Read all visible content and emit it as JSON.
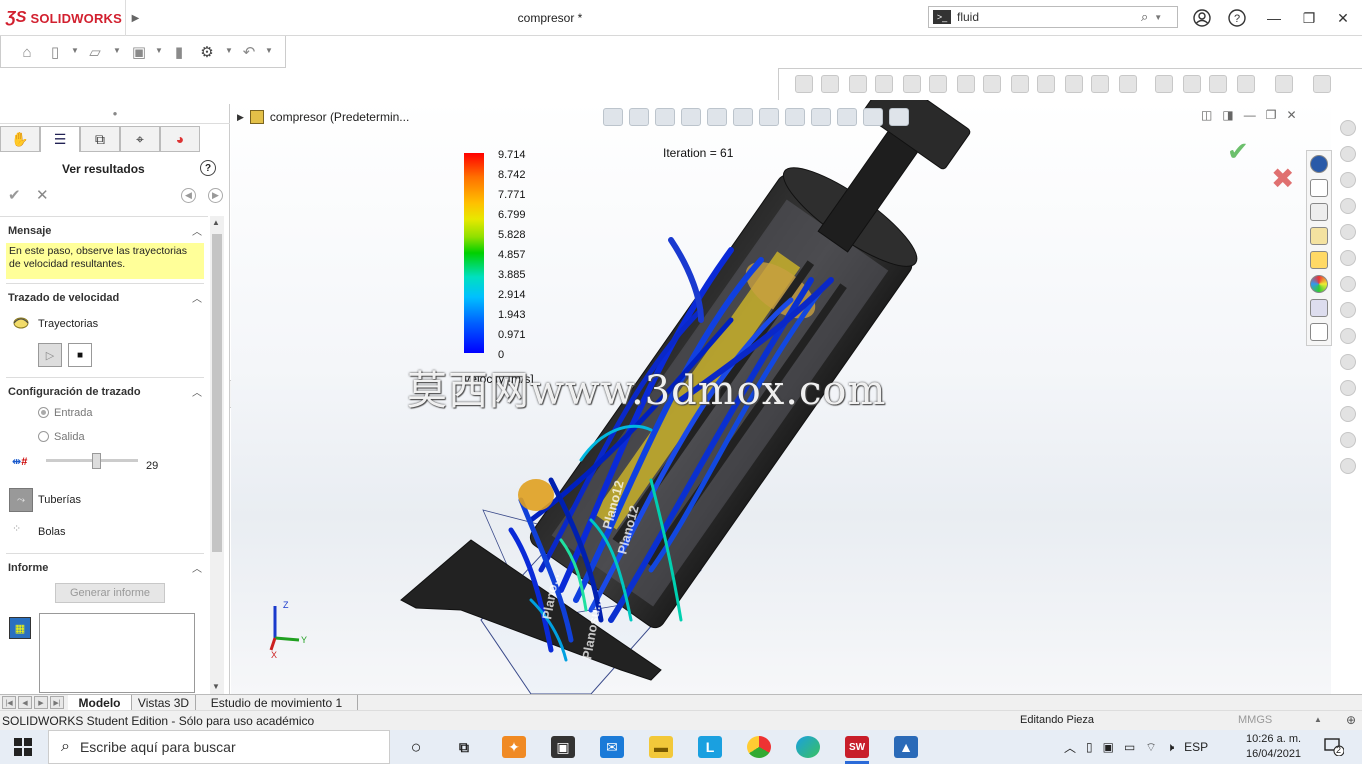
{
  "app": {
    "brand": "SOLIDWORKS",
    "document_title": "compresor *",
    "search_value": "fluid"
  },
  "feature_tree": {
    "root_label": "compresor  (Predetermin..."
  },
  "property_manager": {
    "title": "Ver resultados",
    "message_header": "Mensaje",
    "message_text": "En este paso, observe las trayectorias de velocidad resultantes.",
    "velocity_trace_header": "Trazado de velocidad",
    "trajectories_label": "Trayectorias",
    "trace_config_header": "Configuración de trazado",
    "radio_inlet": "Entrada",
    "radio_outlet": "Salida",
    "slider_value": "29",
    "pipes_label": "Tuberías",
    "balls_label": "Bolas",
    "report_header": "Informe",
    "generate_report_button": "Generar informe"
  },
  "viewport": {
    "iteration_text": "Iteration = 61",
    "legend_values": [
      "9.714",
      "8.742",
      "7.771",
      "6.799",
      "5.828",
      "4.857",
      "3.885",
      "2.914",
      "1.943",
      "0.971",
      "0"
    ],
    "legend_title": "Velocity [m/s]",
    "watermark": "莫西网www.3dmox.com",
    "triad": {
      "z": "Z",
      "y": "Y",
      "x": "X"
    }
  },
  "bottom_tabs": [
    "Modelo",
    "Vistas 3D",
    "Estudio de movimiento 1"
  ],
  "status_bar": {
    "edition": "SOLIDWORKS Student Edition - Sólo para uso académico",
    "mode": "Editando Pieza",
    "units": "MMGS"
  },
  "taskbar": {
    "search_placeholder": "Escribe aquí para buscar",
    "language": "ESP",
    "time": "10:26 a. m.",
    "date": "16/04/2021",
    "notifications": "2"
  },
  "colors": {
    "brand_red": "#d2202f",
    "message_bg": "#ffff99",
    "taskbar_bg": "#e7edf5"
  }
}
